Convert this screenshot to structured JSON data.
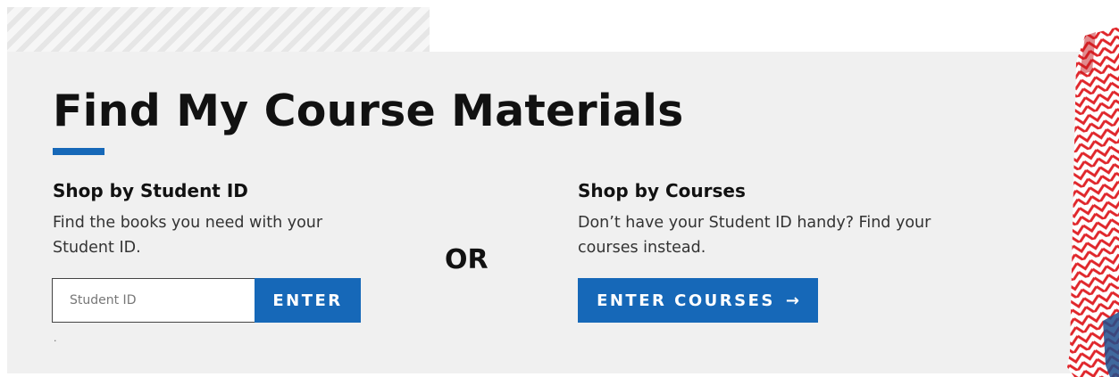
{
  "page": {
    "title": "Find My Course Materials",
    "separator": "OR",
    "footnote": "."
  },
  "student_id": {
    "heading": "Shop by Student ID",
    "description": "Find the books you need with your Student ID.",
    "input_placeholder": "Student ID",
    "input_value": "",
    "button_label": "ENTER"
  },
  "courses": {
    "heading": "Shop by Courses",
    "description": "Don’t have your Student ID handy? Find your courses instead.",
    "button_label": "ENTER COURSES",
    "button_icon": "→",
    "button_icon_name": "arrow-right-icon"
  },
  "colors": {
    "accent": "#1668b8",
    "panel_background": "#f0f0f0",
    "decoration_red": "#e0262b"
  }
}
